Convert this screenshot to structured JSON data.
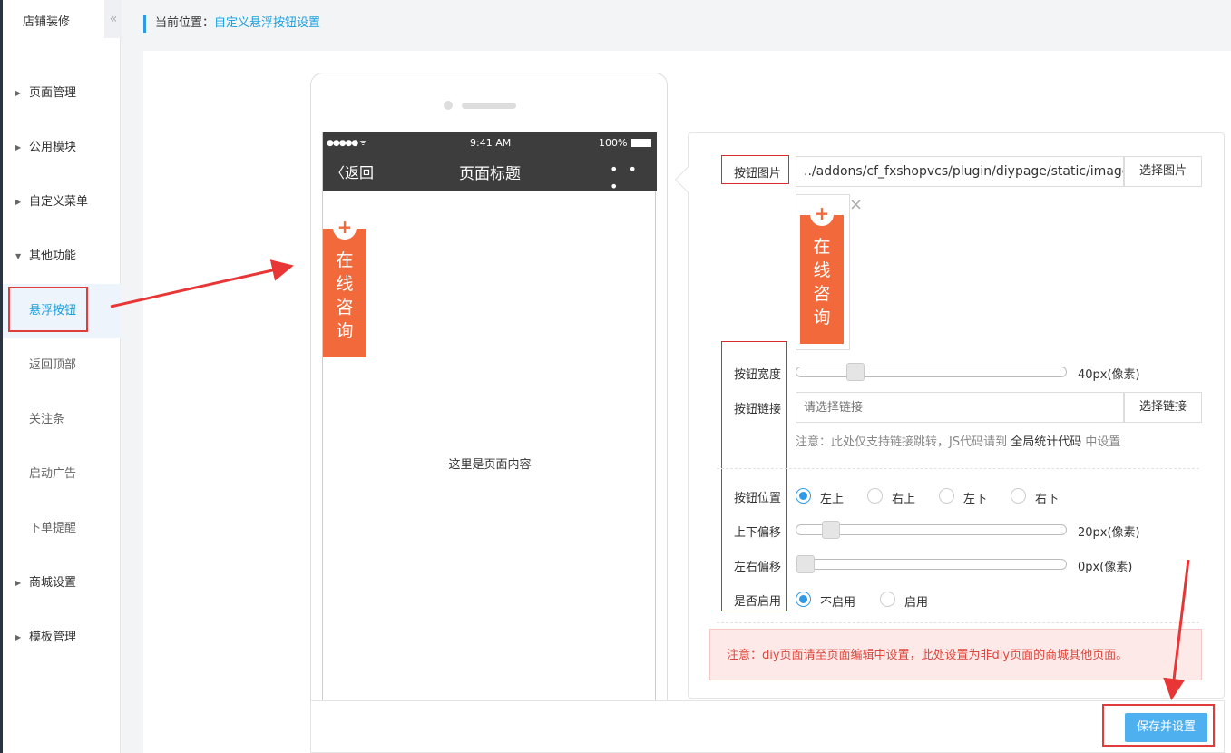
{
  "sidebar": {
    "title": "店铺装修",
    "collapse_glyph": "«",
    "items": [
      {
        "label": "页面管理",
        "arrow": "▶"
      },
      {
        "label": "公用模块",
        "arrow": "▶"
      },
      {
        "label": "自定义菜单",
        "arrow": "▶"
      },
      {
        "label": "其他功能",
        "arrow": "▼"
      },
      {
        "label": "悬浮按钮",
        "active": true
      },
      {
        "label": "返回顶部"
      },
      {
        "label": "关注条"
      },
      {
        "label": "启动广告"
      },
      {
        "label": "下单提醒"
      },
      {
        "label": "商城设置",
        "arrow": "▶"
      },
      {
        "label": "模板管理",
        "arrow": "▶"
      }
    ]
  },
  "header": {
    "prefix": "当前位置：",
    "current": "自定义悬浮按钮设置"
  },
  "phone": {
    "signal": "●●●●● ᯤ",
    "time": "9:41 AM",
    "battery": "100%",
    "back": "〈返回",
    "title": "页面标题",
    "more": "• • •",
    "content": "这里是页面内容",
    "float_button": {
      "plus": "+",
      "chars": [
        "在",
        "线",
        "咨",
        "询"
      ],
      "color": "#f26a3b"
    }
  },
  "settings": {
    "image": {
      "label": "按钮图片",
      "value": "../addons/cf_fxshopvcs/plugin/diypage/static/images/",
      "button": "选择图片",
      "close": "×"
    },
    "width": {
      "label": "按钮宽度",
      "value_text": "40px(像素)",
      "fraction": 0.2
    },
    "link": {
      "label": "按钮链接",
      "placeholder": "请选择链接",
      "button": "选择链接",
      "note_prefix": "注意：此处仅支持链接跳转，JS代码请到 ",
      "note_strong": "全局统计代码",
      "note_suffix": " 中设置"
    },
    "position": {
      "label": "按钮位置",
      "options": [
        "左上",
        "右上",
        "左下",
        "右下"
      ],
      "selected": 0
    },
    "offset_y": {
      "label": "上下偏移",
      "value_text": "20px(像素)",
      "fraction": 0.1
    },
    "offset_x": {
      "label": "左右偏移",
      "value_text": "0px(像素)",
      "fraction": 0.0
    },
    "enabled": {
      "label": "是否启用",
      "options": [
        "不启用",
        "启用"
      ],
      "selected": 0
    },
    "warning": "注意：diy页面请至页面编辑中设置，此处设置为非diy页面的商城其他页面。"
  },
  "footer": {
    "save": "保存并设置"
  },
  "colors": {
    "accent": "#1aa1e0",
    "annotation_red": "#e03c3c",
    "save_button": "#4fb0ef"
  }
}
